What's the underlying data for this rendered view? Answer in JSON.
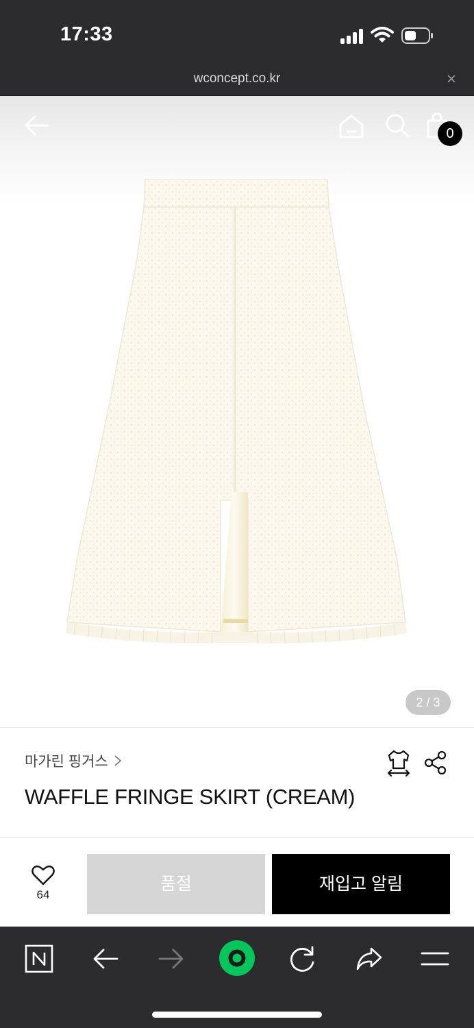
{
  "status_bar": {
    "time": "17:33",
    "icons": [
      "signal-icon",
      "wifi-icon",
      "battery-icon"
    ]
  },
  "browser": {
    "url": "wconcept.co.kr",
    "close_label": "×"
  },
  "header": {
    "icons": [
      "back-arrow-icon",
      "home-icon",
      "search-icon",
      "shopping-bag-icon"
    ],
    "cart_count": "0"
  },
  "gallery": {
    "page_indicator": "2 / 3",
    "image": "cream tweed skirt with fringe hem"
  },
  "product": {
    "brand": "마가린 핑거스",
    "name": "WAFFLE FRINGE SKIRT  (CREAM)",
    "icons": [
      "size-guide-shirt-icon",
      "share-icon"
    ]
  },
  "actions": {
    "like_count": "64",
    "soldout_label": "품절",
    "restock_label": "재입고 알림"
  },
  "toolbar": {
    "icons": [
      "naver-n-icon",
      "back-arrow-icon",
      "forward-arrow-icon",
      "green-circle-icon",
      "reload-icon",
      "share-arrow-icon",
      "menu-icon"
    ]
  },
  "colors": {
    "system_bar": "#2c2c2e",
    "restock_button": "#000000",
    "soldout_button": "#d6d6d6",
    "green_button": "#03c75a"
  }
}
